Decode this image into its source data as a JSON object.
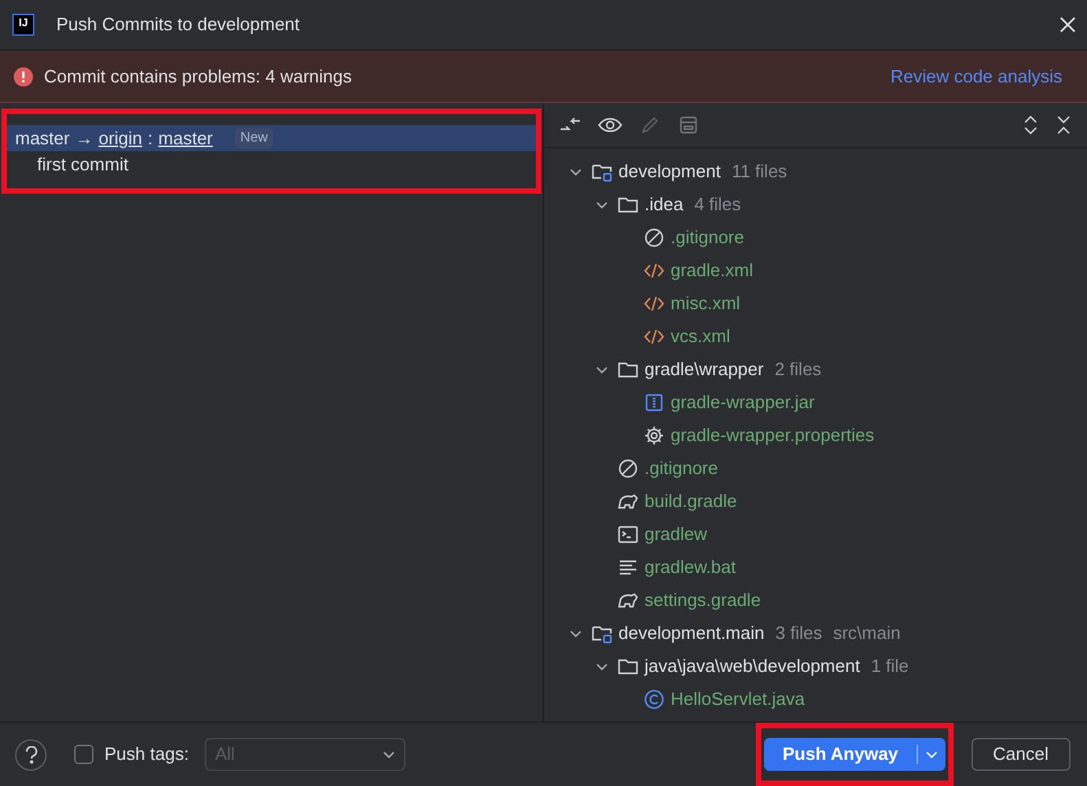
{
  "window": {
    "logo": "IJ",
    "title": "Push Commits to development"
  },
  "problem_banner": {
    "message": "Commit contains problems: 4 warnings",
    "link": "Review code analysis"
  },
  "commits": {
    "branch": {
      "local": "master",
      "arrow": "→",
      "remote": "origin",
      "separator": ":",
      "target": "master",
      "badge": "New",
      "selected": true,
      "highlighted": true
    },
    "items": [
      {
        "message": "first commit"
      }
    ]
  },
  "tree": [
    {
      "kind": "module",
      "name": "development",
      "count": "11 files",
      "expanded": true,
      "children": [
        {
          "kind": "folder",
          "name": ".idea",
          "count": "4 files",
          "expanded": true,
          "children": [
            {
              "kind": "ignore",
              "name": ".gitignore"
            },
            {
              "kind": "xml",
              "name": "gradle.xml"
            },
            {
              "kind": "xml",
              "name": "misc.xml"
            },
            {
              "kind": "xml",
              "name": "vcs.xml"
            }
          ]
        },
        {
          "kind": "folder",
          "name": "gradle\\wrapper",
          "count": "2 files",
          "expanded": true,
          "children": [
            {
              "kind": "jar",
              "name": "gradle-wrapper.jar"
            },
            {
              "kind": "properties",
              "name": "gradle-wrapper.properties"
            }
          ]
        },
        {
          "kind": "ignore",
          "name": ".gitignore"
        },
        {
          "kind": "gradle",
          "name": "build.gradle"
        },
        {
          "kind": "shell",
          "name": "gradlew"
        },
        {
          "kind": "text",
          "name": "gradlew.bat"
        },
        {
          "kind": "gradle",
          "name": "settings.gradle"
        }
      ]
    },
    {
      "kind": "module",
      "name": "development.main",
      "count": "3 files",
      "path": "src\\main",
      "expanded": true,
      "children": [
        {
          "kind": "folder",
          "name": "java\\java\\web\\development",
          "count": "1 file",
          "expanded": true,
          "children": [
            {
              "kind": "class",
              "name": "HelloServlet.java"
            }
          ]
        }
      ]
    }
  ],
  "footer": {
    "push_tags": {
      "label": "Push tags:",
      "checked": false
    },
    "tags_select": {
      "value": "All",
      "disabled": true
    },
    "buttons": [
      {
        "label": "Push Anyway",
        "kind": "primary",
        "highlighted": true
      },
      {
        "label": "Cancel",
        "kind": "secondary",
        "highlighted": false
      }
    ]
  }
}
